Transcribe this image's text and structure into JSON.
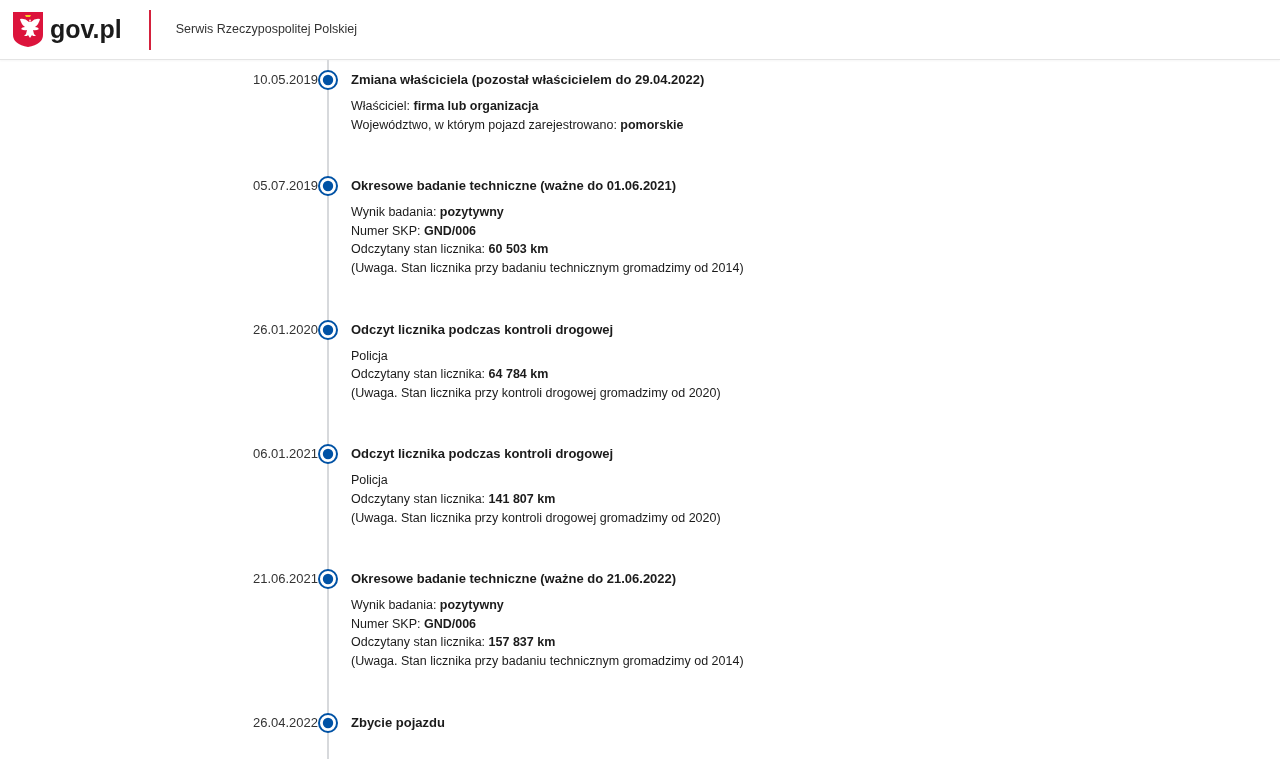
{
  "header": {
    "logo_text": "gov.pl",
    "service_name": "Serwis Rzeczypospolitej Polskiej"
  },
  "timeline": [
    {
      "date": "10.05.2019",
      "title": "Zmiana właściciela (pozostał właścicielem do 29.04.2022)",
      "details": [
        "Właściciel: **firma lub organizacja**",
        "Województwo, w którym pojazd zarejestrowano: **pomorskie**"
      ]
    },
    {
      "date": "05.07.2019",
      "title": "Okresowe badanie techniczne (ważne do 01.06.2021)",
      "details": [
        "Wynik badania: **pozytywny**",
        "Numer SKP: **GND/006**",
        "Odczytany stan licznika: **60 503 km**",
        "(Uwaga. Stan licznika przy badaniu technicznym gromadzimy od 2014)"
      ]
    },
    {
      "date": "26.01.2020",
      "title": "Odczyt licznika podczas kontroli drogowej",
      "details": [
        "Policja",
        "Odczytany stan licznika: **64 784 km**",
        "(Uwaga. Stan licznika przy kontroli drogowej gromadzimy od 2020)"
      ]
    },
    {
      "date": "06.01.2021",
      "title": "Odczyt licznika podczas kontroli drogowej",
      "details": [
        "Policja",
        "Odczytany stan licznika: **141 807 km**",
        "(Uwaga. Stan licznika przy kontroli drogowej gromadzimy od 2020)"
      ]
    },
    {
      "date": "21.06.2021",
      "title": "Okresowe badanie techniczne (ważne do 21.06.2022)",
      "details": [
        "Wynik badania: **pozytywny**",
        "Numer SKP: **GND/006**",
        "Odczytany stan licznika: **157 837 km**",
        "(Uwaga. Stan licznika przy badaniu technicznym gromadzimy od 2014)"
      ]
    },
    {
      "date": "26.04.2022",
      "title": "Zbycie pojazdu"
    }
  ]
}
